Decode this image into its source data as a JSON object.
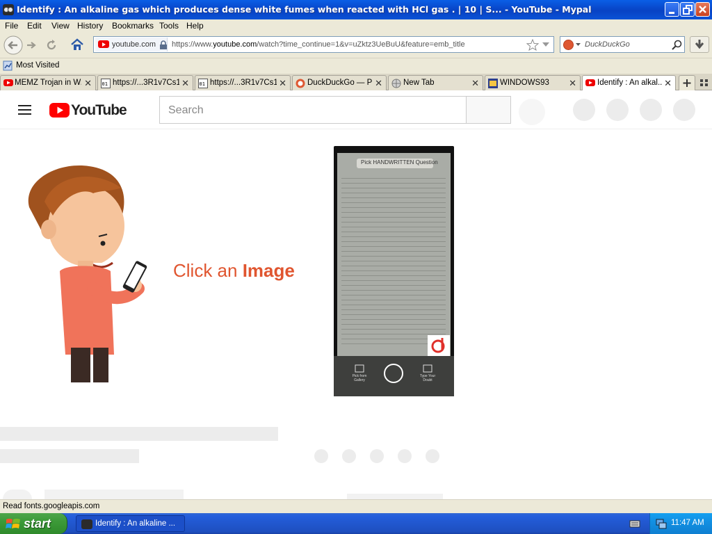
{
  "window": {
    "title": "Identify : An alkaline gas which produces dense white fumes when reacted with HCl gas . | 10 | S... - YouTube - Mypal"
  },
  "menu": {
    "items": [
      {
        "label": "File"
      },
      {
        "label": "Edit"
      },
      {
        "label": "View"
      },
      {
        "label": "History"
      },
      {
        "label": "Bookmarks"
      },
      {
        "label": "Tools"
      },
      {
        "label": "Help"
      }
    ]
  },
  "navbar": {
    "site_identity": "youtube.com",
    "url_prefix": "https://www.",
    "url_domain": "youtube.com",
    "url_path": "/watch?time_continue=1&v=uZktz3UeBuU&feature=emb_title",
    "search_placeholder": "DuckDuckGo"
  },
  "bookmarks": {
    "items": [
      {
        "label": "Most Visited"
      }
    ]
  },
  "tabs": [
    {
      "label": "MEMZ Trojan in W...",
      "icon": "youtube-icon",
      "active": false
    },
    {
      "label": "https://...3R1v7Cs1",
      "icon": "page-icon",
      "active": false
    },
    {
      "label": "https://...3R1v7Cs1",
      "icon": "page-icon",
      "active": false
    },
    {
      "label": "DuckDuckGo — Pr...",
      "icon": "duckduckgo-icon",
      "active": false
    },
    {
      "label": "New Tab",
      "icon": "globe-icon",
      "active": false
    },
    {
      "label": "WINDOWS93",
      "icon": "window-icon",
      "active": false
    },
    {
      "label": "Identify : An alkal...",
      "icon": "youtube-icon",
      "active": true
    }
  ],
  "youtube": {
    "logo_text": "YouTube",
    "search_placeholder": "Search",
    "video": {
      "caption_regular": "Click an ",
      "caption_bold": "Image",
      "phone_header": "Pick HANDWRITTEN Question",
      "phone_left_label": "Pick from Gallery",
      "phone_right_label": "Type Your Doubt"
    }
  },
  "statusbar": {
    "text": "Read fonts.googleapis.com"
  },
  "taskbar": {
    "start_label": "start",
    "task_label": "Identify : An alkaline ...",
    "clock": "11:47 AM"
  },
  "colors": {
    "titlebar": "#0842c4",
    "youtube_red": "#ff0000",
    "caption_orange": "#e0552f",
    "taskbar_blue": "#245edb",
    "start_green": "#3c9a38"
  }
}
